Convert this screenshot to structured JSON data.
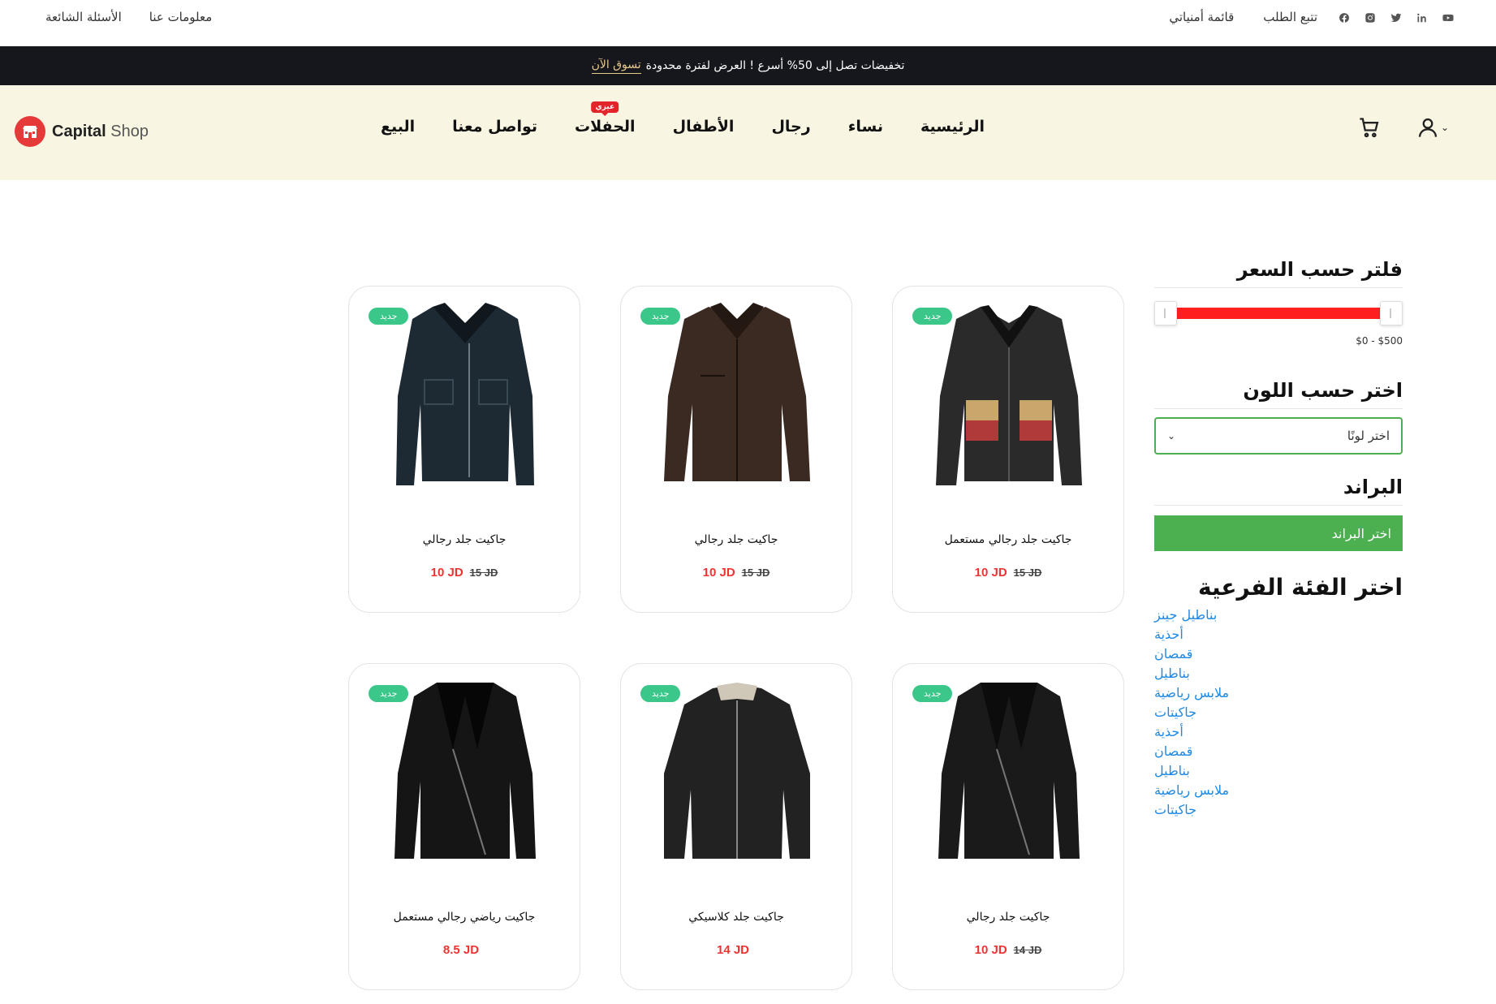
{
  "topbar": {
    "links_right": [
      "تتبع الطلب",
      "قائمة أمنياتي"
    ],
    "links_left": [
      "الأسئلة الشائعة",
      "معلومات عنا"
    ],
    "social_icons": [
      "youtube-icon",
      "linkedin-icon",
      "twitter-icon",
      "instagram-icon",
      "facebook-icon"
    ]
  },
  "promo": {
    "text": "تخفيضات تصل إلى 50% أسرع ! العرض لفترة محدودة",
    "link": "تسوق الآن"
  },
  "nav": {
    "logo_bold": "Capital",
    "logo_light": " Shop",
    "items": [
      "الرئيسية",
      "نساء",
      "رجال",
      "الأطفال",
      "الحفلات",
      "تواصل معنا",
      "البيع"
    ],
    "hot_badge": "عيزي",
    "accent_color": "#e63939"
  },
  "sidebar": {
    "price_title": "فلتر حسب السعر",
    "price_range": "$0 - $500",
    "price_min": 0,
    "price_max": 500,
    "color_title": "اختر حسب اللون",
    "color_placeholder": "اختر لونًا",
    "brand_title": "البراند",
    "brand_button": "اختر البراند",
    "sub_title": "اختر الفئة الفرعية",
    "sub_items": [
      "بناطيل جينز",
      "أحذية",
      "قمصان",
      "بناطيل",
      "ملابس رياضية",
      "جاكيتات",
      "أحذية",
      "قمصان",
      "بناطيل",
      "ملابس رياضية",
      "جاكيتات"
    ]
  },
  "products": [
    {
      "badge": "جديد",
      "name": "جاكيت جلد رجالي مستعمل",
      "price": "10 JD",
      "old_price": "15 JD"
    },
    {
      "badge": "جديد",
      "name": "جاكيت جلد رجالي",
      "price": "10 JD",
      "old_price": "15 JD"
    },
    {
      "badge": "جديد",
      "name": "جاكيت جلد رجالي",
      "price": "10 JD",
      "old_price": "15 JD"
    },
    {
      "badge": "جديد",
      "name": "جاكيت جلد رجالي",
      "price": "10 JD",
      "old_price": "14 JD"
    },
    {
      "badge": "جديد",
      "name": "جاكيت جلد كلاسيكي",
      "price": "14 JD",
      "old_price": ""
    },
    {
      "badge": "جديد",
      "name": "جاكيت رياضي رجالي مستعمل",
      "price": "8.5 JD",
      "old_price": ""
    }
  ]
}
